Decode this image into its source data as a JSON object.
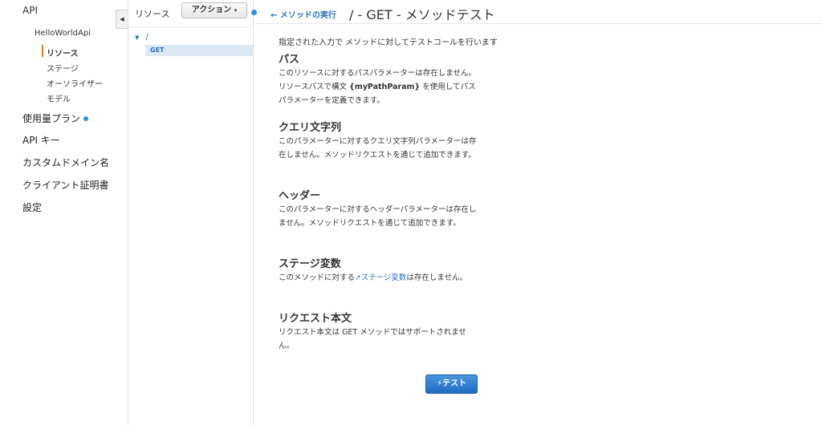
{
  "nav": {
    "api": "API",
    "api_name": "HelloWorldApi",
    "sub_items": [
      {
        "label": "リソース"
      },
      {
        "label": "ステージ"
      },
      {
        "label": "オーソライザー"
      },
      {
        "label": "モデル"
      }
    ],
    "main_items": [
      {
        "label": "使用量プラン"
      },
      {
        "label": "API キー"
      },
      {
        "label": "カスタムドメイン名"
      },
      {
        "label": "クライアント証明書"
      },
      {
        "label": "設定"
      }
    ],
    "accent_color": "#ec7211",
    "dot_color": "#2f8ce0"
  },
  "resources": {
    "title": "リソース",
    "action_label": "アクション",
    "root_path": "/",
    "method": "GET"
  },
  "main": {
    "back_label": "メソッドの実行",
    "title": "/ - GET - メソッドテスト",
    "description": "指定された入力で メソッドに対してテストコールを行います",
    "sections": {
      "path": {
        "title": "パス",
        "body_pre": "このリソースに対するパスパラメーターは存在しません。リソースパスで構文 ",
        "body_code": "{myPathParam}",
        "body_post": " を使用してパスパラメーターを定義できます。"
      },
      "query": {
        "title": "クエリ文字列",
        "body": "このパラメーターに対するクエリ文字列パラメーターは存在しません。メソッドリクエストを通じて追加できます。"
      },
      "header": {
        "title": "ヘッダー",
        "body": "このパラメーターに対するヘッダーパラメーターは存在しません。メソッドリクエストを通じて追加できます。"
      },
      "stage_vars": {
        "title": "ステージ変数",
        "body_pre": "このメソッドに対する",
        "link": "ステージ変数",
        "body_post": "は存在しません。"
      },
      "request_body": {
        "title": "リクエスト本文",
        "body": "リクエスト本文は GET メソッドではサポートされません。"
      }
    },
    "test_button": "テスト",
    "link_color": "#2f6fb7"
  }
}
